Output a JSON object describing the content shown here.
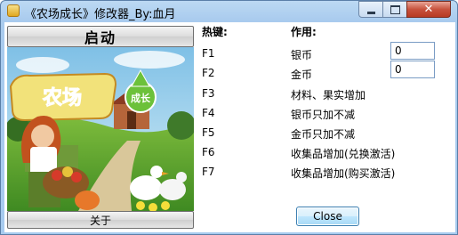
{
  "window": {
    "title": "《农场成长》修改器_By:血月",
    "controls": [
      "minimize",
      "maximize",
      "close"
    ]
  },
  "left": {
    "start_label": "启动",
    "about_label": "关于",
    "logo_text": "农场",
    "badge_text": "成长"
  },
  "table": {
    "hotkey_header": "热键:",
    "action_header": "作用:",
    "rows": [
      {
        "key": "F1",
        "action": "银币",
        "value": "0"
      },
      {
        "key": "F2",
        "action": "金币",
        "value": "0"
      },
      {
        "key": "F3",
        "action": "材料、果实增加"
      },
      {
        "key": "F4",
        "action": "银币只加不减"
      },
      {
        "key": "F5",
        "action": "金币只加不减"
      },
      {
        "key": "F6",
        "action": "收集品增加(兑换激活)"
      },
      {
        "key": "F7",
        "action": "收集品增加(购买激活)"
      }
    ]
  },
  "close_label": "Close"
}
